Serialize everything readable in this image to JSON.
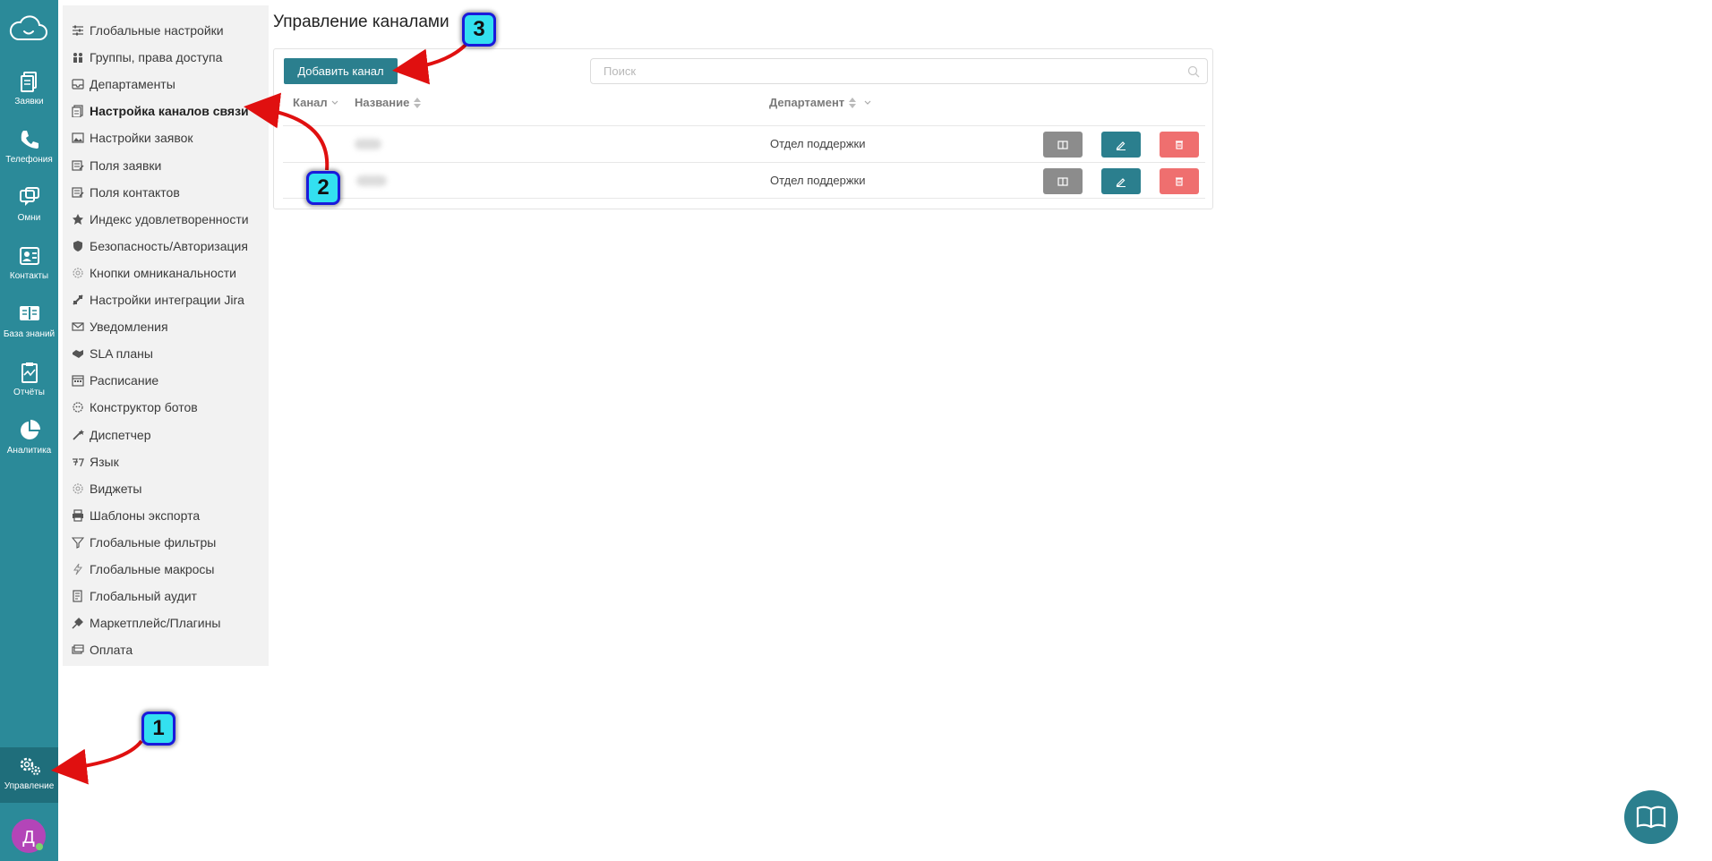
{
  "rail": {
    "items": [
      {
        "label": "Заявки",
        "icon": "tickets-icon"
      },
      {
        "label": "Телефония",
        "icon": "phone-icon"
      },
      {
        "label": "Омни",
        "icon": "omni-chat-icon"
      },
      {
        "label": "Контакты",
        "icon": "contacts-icon"
      },
      {
        "label": "База знаний",
        "icon": "knowledge-base-icon"
      },
      {
        "label": "Отчёты",
        "icon": "reports-icon"
      },
      {
        "label": "Аналитика",
        "icon": "analytics-pie-icon"
      }
    ],
    "settings_label": "Управление",
    "avatar_letter": "Д"
  },
  "menu": {
    "items": [
      {
        "label": "Глобальные настройки",
        "icon": "sliders-icon"
      },
      {
        "label": "Группы, права доступа",
        "icon": "users-group-icon"
      },
      {
        "label": "Департаменты",
        "icon": "inbox-icon"
      },
      {
        "label": "Настройка каналов связи",
        "icon": "channels-icon"
      },
      {
        "label": "Настройки заявок",
        "icon": "image-icon"
      },
      {
        "label": "Поля заявки",
        "icon": "fields-icon"
      },
      {
        "label": "Поля контактов",
        "icon": "contact-fields-icon"
      },
      {
        "label": "Индекс удовлетворенности",
        "icon": "star-icon"
      },
      {
        "label": "Безопасность/Авторизация",
        "icon": "shield-icon"
      },
      {
        "label": "Кнопки омниканальности",
        "icon": "gear-outline-icon"
      },
      {
        "label": "Настройки интеграции Jira",
        "icon": "jira-icon"
      },
      {
        "label": "Уведомления",
        "icon": "envelope-icon"
      },
      {
        "label": "SLA планы",
        "icon": "handshake-icon"
      },
      {
        "label": "Расписание",
        "icon": "calendar-icon"
      },
      {
        "label": "Конструктор ботов",
        "icon": "bot-icon"
      },
      {
        "label": "Диспетчер",
        "icon": "magic-wand-icon"
      },
      {
        "label": "Язык",
        "icon": "language-icon"
      },
      {
        "label": "Виджеты",
        "icon": "widget-gear-icon"
      },
      {
        "label": "Шаблоны экспорта",
        "icon": "printer-icon"
      },
      {
        "label": "Глобальные фильтры",
        "icon": "filter-icon"
      },
      {
        "label": "Глобальные макросы",
        "icon": "lightning-icon"
      },
      {
        "label": "Глобальный аудит",
        "icon": "audit-icon"
      },
      {
        "label": "Маркетплейс/Плагины",
        "icon": "plug-icon"
      },
      {
        "label": "Оплата",
        "icon": "payment-icon"
      }
    ],
    "active_index": 3
  },
  "main": {
    "title": "Управление каналами",
    "add_button": "Добавить канал",
    "search_placeholder": "Поиск",
    "columns": {
      "channel": "Канал",
      "name": "Название",
      "department": "Департамент"
    },
    "rows": [
      {
        "department": "Отдел поддержки"
      },
      {
        "department": "Отдел поддержки"
      }
    ]
  },
  "annotations": [
    "1",
    "2",
    "3"
  ],
  "colors": {
    "rail": "#2b8a99",
    "primary_button": "#2b7f8e",
    "view_button": "#8c8c8c",
    "delete_button": "#ef6f6f",
    "badge_fill": "#33e0f0",
    "badge_border": "#1a1adb",
    "arrow": "#e01010"
  }
}
